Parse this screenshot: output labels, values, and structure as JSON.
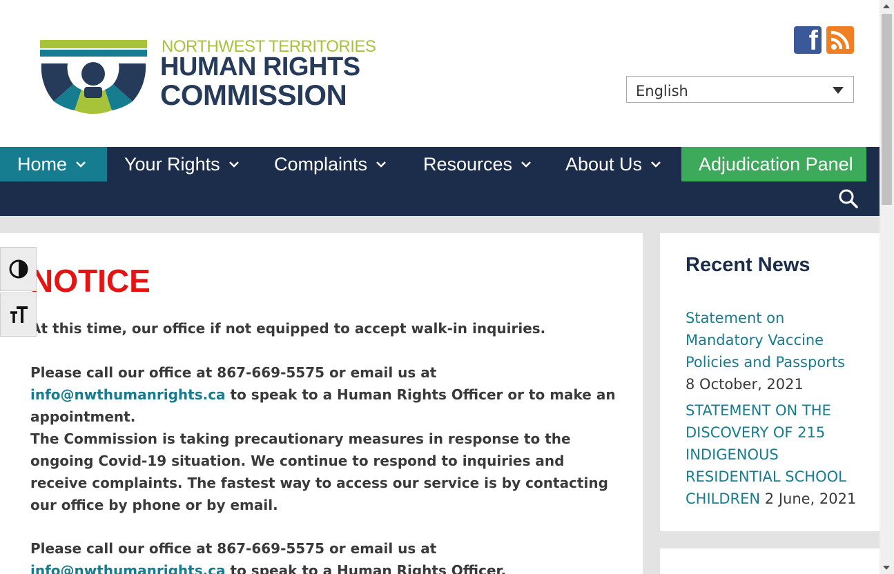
{
  "header": {
    "logo": {
      "line1": "NORTHWEST TERRITORIES",
      "line2": "HUMAN RIGHTS",
      "line3": "COMMISSION"
    },
    "social": [
      {
        "name": "facebook-icon",
        "glyph": "f"
      },
      {
        "name": "rss-icon"
      }
    ],
    "language": {
      "selected": "English"
    }
  },
  "nav": {
    "items": [
      {
        "label": "Home"
      },
      {
        "label": "Your Rights"
      },
      {
        "label": "Complaints"
      },
      {
        "label": "Resources"
      },
      {
        "label": "About Us"
      },
      {
        "label": "Adjudication Panel"
      }
    ],
    "chevron": "⌄",
    "active_color": "#167d91",
    "panel_color": "#3daa5b",
    "nav_bg": "#1c2d4b"
  },
  "main": {
    "notice_title": "NOTICE",
    "p1": "At this time, our office if not equipped to accept walk-in inquiries.",
    "p2_before": "Please call our office at 867-669-5575 or email us at ",
    "p2_link": "info@nwthumanrights.ca",
    "p2_after": " to speak to a Human Rights Officer or to make an appointment.",
    "p3": "The Commission is taking precautionary measures in response to the ongoing Covid-19 situation. We continue to respond to inquiries and receive complaints. The fastest way to access our service is by contacting our office by phone or by email.",
    "p4_before": "Please call our office at 867-669-5575 or email us at ",
    "p4_link": "info@nwthumanrights.ca",
    "p4_after": " to speak to a Human Rights Officer."
  },
  "sidebar": {
    "title": "Recent News",
    "news": [
      {
        "title": "Statement on Mandatory Vaccine Policies and Passports",
        "date": "8 October, 2021"
      },
      {
        "title": "STATEMENT ON THE DISCOVERY OF 215 INDIGENOUS RESIDENTIAL SCHOOL CHILDREN",
        "date": "2 June, 2021"
      }
    ]
  },
  "a11y": {
    "contrast_icon": "contrast-icon",
    "text_size_icon": "text-size-icon"
  }
}
